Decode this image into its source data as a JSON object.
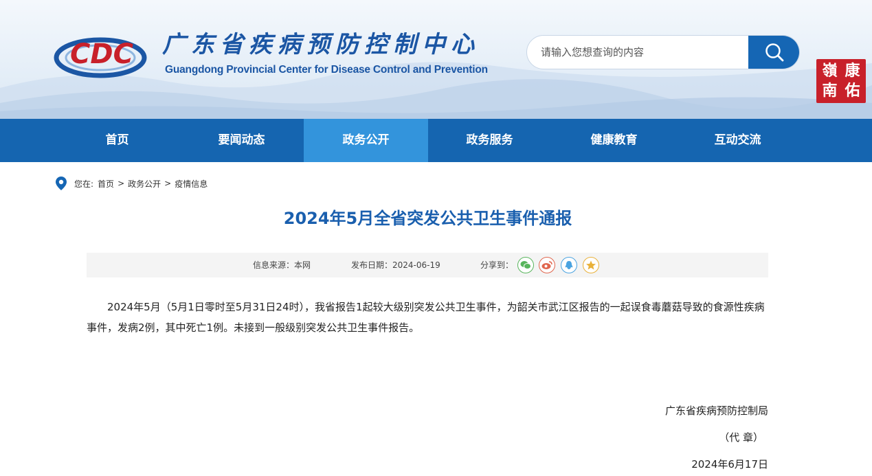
{
  "header": {
    "logo_text": "CDC",
    "site_title_cn": "广东省疾病预防控制中心",
    "site_title_en": "Guangdong Provincial Center for Disease Control and Prevention",
    "search": {
      "placeholder": "请输入您想查询的内容"
    },
    "seal_chars": [
      "嶺",
      "康",
      "南",
      "佑"
    ],
    "brand_color": "#1566b4",
    "seal_color": "#c8202a"
  },
  "nav": {
    "items": [
      {
        "label": "首页"
      },
      {
        "label": "要闻动态"
      },
      {
        "label": "政务公开",
        "active": true
      },
      {
        "label": "政务服务"
      },
      {
        "label": "健康教育"
      },
      {
        "label": "互动交流"
      }
    ],
    "active_color": "#3394dc"
  },
  "breadcrumb": {
    "prefix": "您在:",
    "items": [
      "首页",
      "政务公开",
      "疫情信息"
    ],
    "separator": ">"
  },
  "article": {
    "title": "2024年5月全省突发公共卫生事件通报",
    "source_label": "信息来源：",
    "source_value": "本网",
    "date_label": "发布日期：",
    "date_value": "2024-06-19",
    "share_label": "分享到：",
    "share_icons": [
      "wechat-icon",
      "weibo-icon",
      "qq-icon",
      "star-icon"
    ],
    "body": "2024年5月（5月1日零时至5月31日24时），我省报告1起较大级别突发公共卫生事件，为韶关市武江区报告的一起误食毒蘑菇导致的食源性疾病事件，发病2例，其中死亡1例。未接到一般级别突发公共卫生事件报告。",
    "signature_org": "广东省疾病预防控制局",
    "signature_seal": "（代 章）",
    "signature_date": "2024年6月17日"
  }
}
